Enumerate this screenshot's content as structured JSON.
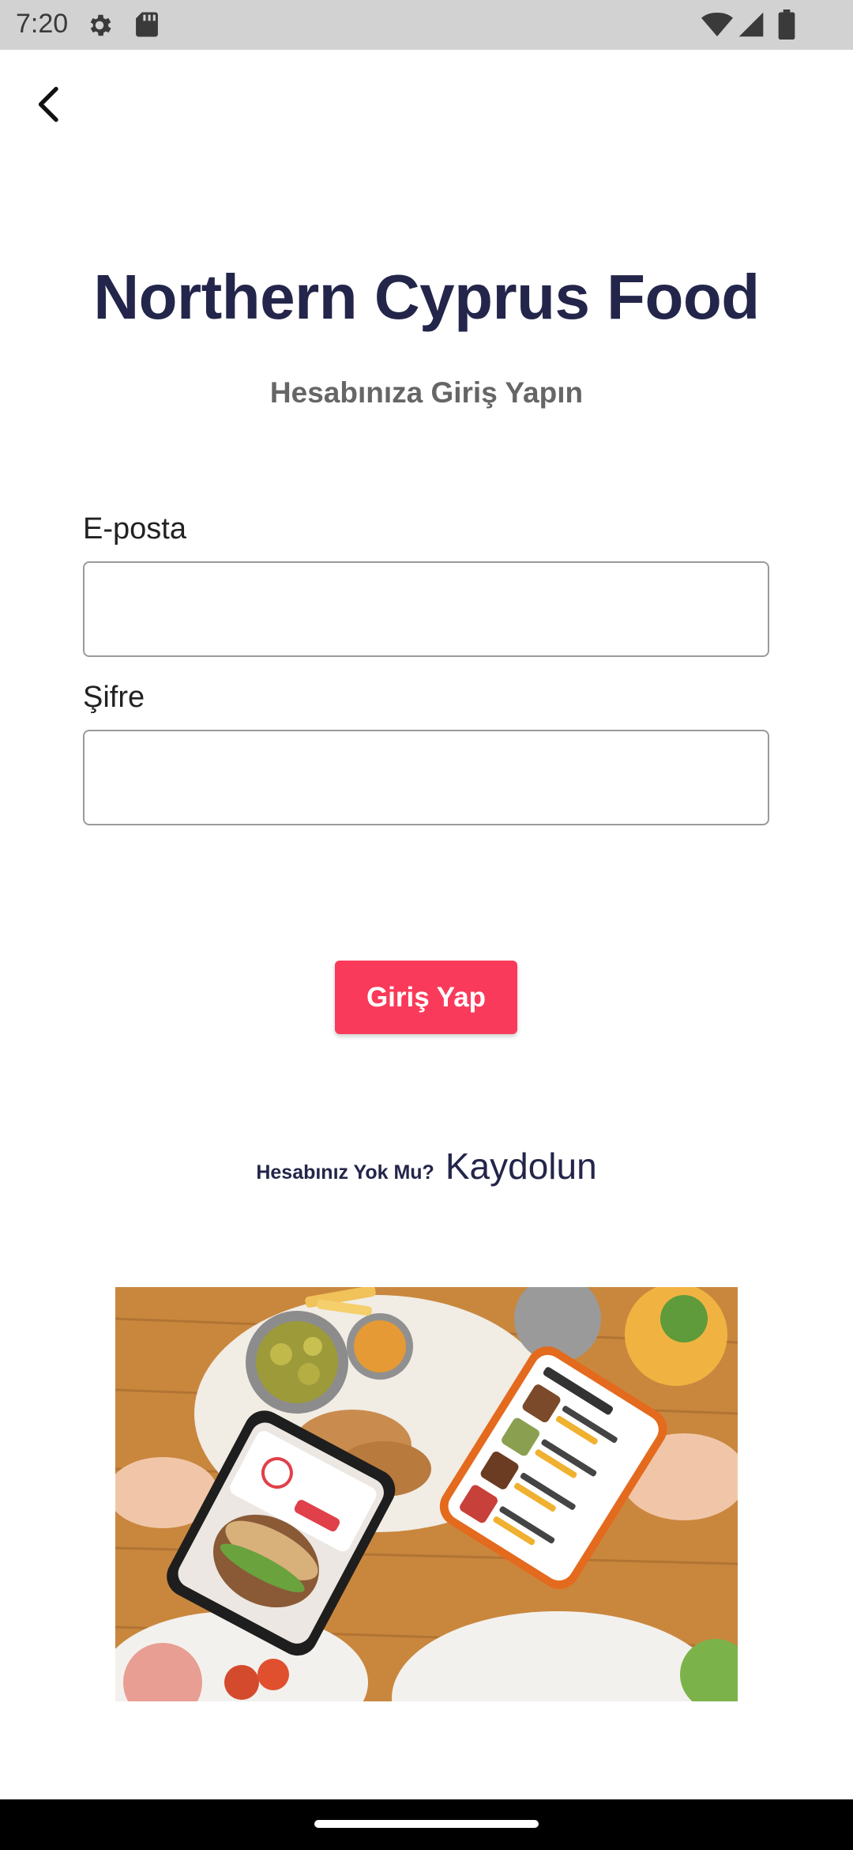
{
  "status_bar": {
    "time": "7:20",
    "icons": [
      "settings-icon",
      "sd-card-icon",
      "wifi-icon",
      "signal-icon",
      "battery-icon"
    ]
  },
  "header": {
    "back_icon": "chevron-left-icon"
  },
  "login": {
    "title": "Northern Cyprus Food",
    "subtitle": "Hesabınıza Giriş Yapın",
    "email_label": "E-posta",
    "email_value": "",
    "password_label": "Şifre",
    "password_value": "",
    "submit_label": "Giriş Yap",
    "register_prompt": "Hesabınız Yok Mu?",
    "register_link": "Kaydolun"
  },
  "hero_image": {
    "description_icon": "food-phones-illustration"
  },
  "colors": {
    "title": "#23254a",
    "subtitle": "#666666",
    "accent": "#fa3a5a",
    "status_bar": "#d2d2d2",
    "nav_bar": "#000000"
  }
}
